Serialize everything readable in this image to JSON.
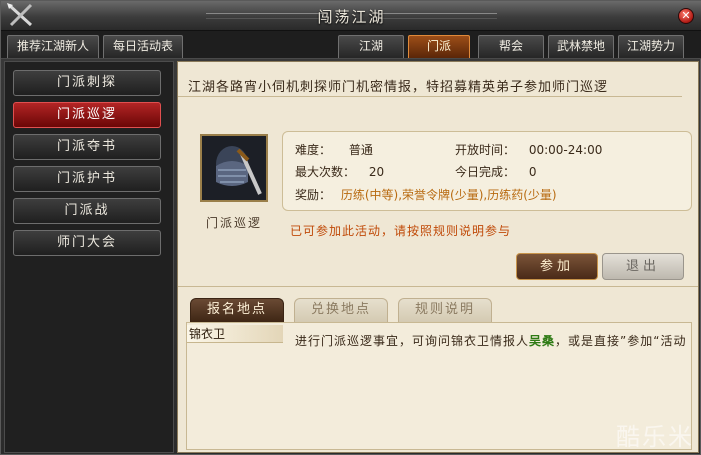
{
  "window": {
    "title": "闯荡江湖"
  },
  "tabs_left": [
    {
      "label": "推荐江湖新人"
    },
    {
      "label": "每日活动表"
    }
  ],
  "tabs_right": [
    {
      "label": "江湖"
    },
    {
      "label": "门派"
    },
    {
      "label": "帮会"
    },
    {
      "label": "武林禁地"
    },
    {
      "label": "江湖势力"
    }
  ],
  "sidebar": {
    "items": [
      {
        "label": "门派刺探"
      },
      {
        "label": "门派巡逻"
      },
      {
        "label": "门派夺书"
      },
      {
        "label": "门派护书"
      },
      {
        "label": "门派战"
      },
      {
        "label": "师门大会"
      }
    ]
  },
  "main": {
    "intro": "江湖各路宵小伺机刺探师门机密情报，特招募精英弟子参加师门巡逻",
    "portrait_caption": "门派巡逻",
    "info": {
      "difficulty_label": "难度：",
      "difficulty_value": "普通",
      "open_time_label": "开放时间：",
      "open_time_value": "00:00-24:00",
      "max_times_label": "最大次数：",
      "max_times_value": "20",
      "done_today_label": "今日完成：",
      "done_today_value": "0",
      "reward_label": "奖励：",
      "reward_value": "历练(中等),荣誉令牌(少量),历练药(少量)"
    },
    "notice": "已可参加此活动，请按照规则说明参与",
    "join_label": "参加",
    "exit_label": "退出",
    "subtabs": [
      {
        "label": "报名地点"
      },
      {
        "label": "兑换地点"
      },
      {
        "label": "规则说明"
      }
    ],
    "location_item": "锦衣卫",
    "detail_prefix": "进行门派巡逻事宜，可询问锦衣卫情报人",
    "detail_npc": "吴桑",
    "detail_suffix": "，或是直接”参加“活动"
  },
  "watermark": "酷乐米",
  "colors": {
    "active_tab": "#9c4e18",
    "active_sidebar": "#b32525",
    "parchment": "#efe7d4",
    "notice": "#c04a08",
    "npc_name": "#2e7a14"
  }
}
